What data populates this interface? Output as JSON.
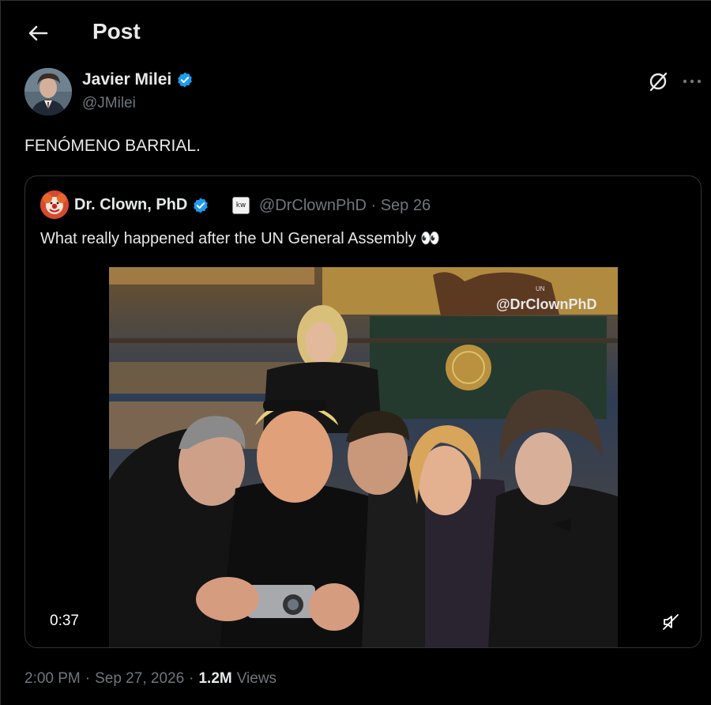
{
  "header": {
    "title": "Post",
    "back_icon": "arrow-left-icon"
  },
  "post": {
    "author": {
      "name": "Javier Milei",
      "handle": "@JMilei",
      "verified": true,
      "avatar_icon": "avatar"
    },
    "text": "FENÓMENO BARRIAL.",
    "actions": {
      "grok_icon": "grok-icon",
      "more_icon": "more-icon"
    },
    "quote": {
      "author": {
        "name": "Dr. Clown, PhD",
        "handle": "@DrClownPhD",
        "verified": true,
        "affiliate_badge": "kw"
      },
      "date_sep": "·",
      "date": "Sep 26",
      "text": "What really happened after the UN General Assembly 👀",
      "media": {
        "watermark": "@DrClownPhD",
        "podium_sign": "UN",
        "video_time": "0:37",
        "mute_icon": "muted-speaker-icon"
      }
    },
    "meta": {
      "time": "2:00 PM",
      "sep1": "·",
      "date": "Sep 27, 2026",
      "sep2": "·",
      "views_count": "1.2M",
      "views_label": "Views"
    }
  },
  "colors": {
    "background": "#000000",
    "text": "#e7e9ea",
    "muted": "#71767b",
    "verified": "#1d9bf0",
    "border": "#2f3336"
  }
}
